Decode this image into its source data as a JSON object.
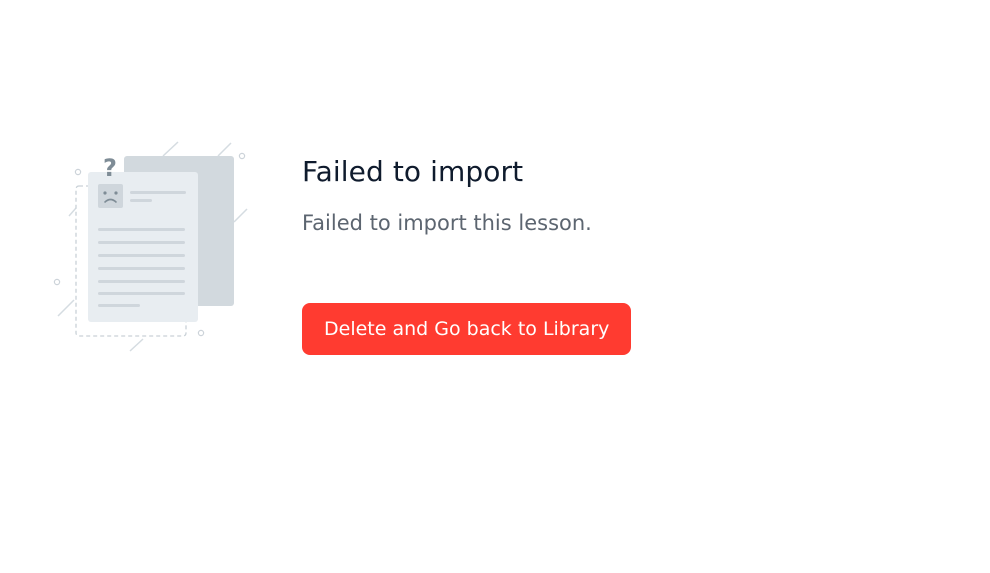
{
  "error_state": {
    "title": "Failed to import",
    "message": "Failed to import this lesson.",
    "action_label": "Delete and Go back to Library"
  },
  "illustration": {
    "icon": "failed-document-icon",
    "question_mark": "?",
    "colors": {
      "front_page": "#e8edf1",
      "back_page": "#d2d9de",
      "lines": "#cfd6dc",
      "dashed_outline": "#c9d1d7",
      "question_mark": "#7e8c96"
    }
  },
  "colors": {
    "accent_danger": "#ff3b30",
    "title_text": "#0f1b2d",
    "body_text": "#5c6570"
  }
}
